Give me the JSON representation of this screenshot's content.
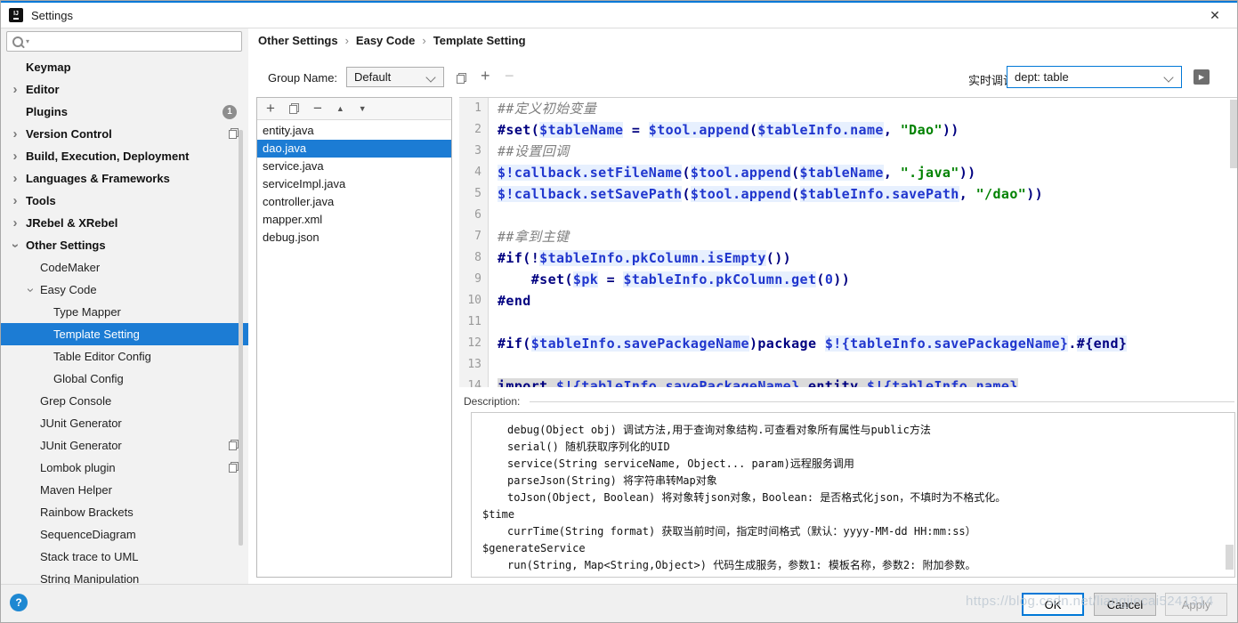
{
  "window": {
    "title": "Settings",
    "close_icon": "✕"
  },
  "colors": {
    "accent_blue": "#0078D7",
    "selection_blue": "#1C7CD4",
    "keyword": "#000080",
    "variable": "#2036CE",
    "string": "#008200",
    "comment": "#808080",
    "help_blue": "#1E88D2"
  },
  "sidebar": {
    "search_value": "",
    "items": [
      {
        "label": "Keymap",
        "level": 1,
        "bold": true
      },
      {
        "label": "Editor",
        "level": 1,
        "bold": true,
        "chevron": "collapsed"
      },
      {
        "label": "Plugins",
        "level": 1,
        "bold": true,
        "badge": "1"
      },
      {
        "label": "Version Control",
        "level": 1,
        "bold": true,
        "chevron": "collapsed",
        "right_icon": "duplicate-icon"
      },
      {
        "label": "Build, Execution, Deployment",
        "level": 1,
        "bold": true,
        "chevron": "collapsed"
      },
      {
        "label": "Languages & Frameworks",
        "level": 1,
        "bold": true,
        "chevron": "collapsed"
      },
      {
        "label": "Tools",
        "level": 1,
        "bold": true,
        "chevron": "collapsed"
      },
      {
        "label": "JRebel & XRebel",
        "level": 1,
        "bold": true,
        "chevron": "collapsed"
      },
      {
        "label": "Other Settings",
        "level": 1,
        "bold": true,
        "chevron": "expanded"
      },
      {
        "label": "CodeMaker",
        "level": 2
      },
      {
        "label": "Easy Code",
        "level": 2,
        "chevron": "expanded"
      },
      {
        "label": "Type Mapper",
        "level": 3
      },
      {
        "label": "Template Setting",
        "level": 3,
        "selected": true
      },
      {
        "label": "Table Editor Config",
        "level": 3
      },
      {
        "label": "Global Config",
        "level": 3
      },
      {
        "label": "Grep Console",
        "level": 2
      },
      {
        "label": "JUnit Generator",
        "level": 2
      },
      {
        "label": "JUnit Generator",
        "level": 2,
        "right_icon": "duplicate-icon"
      },
      {
        "label": "Lombok plugin",
        "level": 2,
        "right_icon": "duplicate-icon"
      },
      {
        "label": "Maven Helper",
        "level": 2
      },
      {
        "label": "Rainbow Brackets",
        "level": 2
      },
      {
        "label": "SequenceDiagram",
        "level": 2
      },
      {
        "label": "Stack trace to UML",
        "level": 2
      },
      {
        "label": "String Manipulation",
        "level": 2
      }
    ]
  },
  "breadcrumb": {
    "items": [
      "Other Settings",
      "Easy Code",
      "Template Setting"
    ],
    "separator": "›"
  },
  "group_row": {
    "label": "Group Name:",
    "value": "Default",
    "icons": {
      "duplicate": "duplicate-icon",
      "add": "+",
      "remove": "−"
    }
  },
  "debug_row": {
    "label": "实时调试",
    "value": "dept: table",
    "run_icon": "▶"
  },
  "file_panel": {
    "toolbar": {
      "add": "+",
      "duplicate": "duplicate-icon",
      "remove": "−",
      "move_up": "▲",
      "move_down": "▼"
    },
    "files": [
      {
        "name": "entity.java"
      },
      {
        "name": "dao.java",
        "selected": true
      },
      {
        "name": "service.java"
      },
      {
        "name": "serviceImpl.java"
      },
      {
        "name": "controller.java"
      },
      {
        "name": "mapper.xml"
      },
      {
        "name": "debug.json"
      }
    ]
  },
  "editor": {
    "lines": [
      {
        "num": "1",
        "tokens": [
          {
            "c": "com",
            "t": "##定义初始变量"
          }
        ]
      },
      {
        "num": "2",
        "tokens": [
          {
            "c": "kw",
            "t": "#set("
          },
          {
            "c": "var hl",
            "t": "$tableName"
          },
          {
            "c": "kw",
            "t": " = "
          },
          {
            "c": "var hl",
            "t": "$tool.append"
          },
          {
            "c": "kw",
            "t": "("
          },
          {
            "c": "var hl",
            "t": "$tableInfo.name"
          },
          {
            "c": "kw",
            "t": ", "
          },
          {
            "c": "str",
            "t": "\"Dao\""
          },
          {
            "c": "kw",
            "t": "))"
          }
        ]
      },
      {
        "num": "3",
        "tokens": [
          {
            "c": "com",
            "t": "##设置回调"
          }
        ]
      },
      {
        "num": "4",
        "tokens": [
          {
            "c": "var hl",
            "t": "$!callback.setFileName"
          },
          {
            "c": "kw",
            "t": "("
          },
          {
            "c": "var hl",
            "t": "$tool.append"
          },
          {
            "c": "kw",
            "t": "("
          },
          {
            "c": "var hl",
            "t": "$tableName"
          },
          {
            "c": "kw",
            "t": ", "
          },
          {
            "c": "str",
            "t": "\".java\""
          },
          {
            "c": "kw",
            "t": "))"
          }
        ]
      },
      {
        "num": "5",
        "tokens": [
          {
            "c": "var hl",
            "t": "$!callback.setSavePath"
          },
          {
            "c": "kw",
            "t": "("
          },
          {
            "c": "var hl",
            "t": "$tool.append"
          },
          {
            "c": "kw",
            "t": "("
          },
          {
            "c": "var hl",
            "t": "$tableInfo.savePath"
          },
          {
            "c": "kw",
            "t": ", "
          },
          {
            "c": "str",
            "t": "\"/dao\""
          },
          {
            "c": "kw",
            "t": "))"
          }
        ]
      },
      {
        "num": "6",
        "tokens": []
      },
      {
        "num": "7",
        "tokens": [
          {
            "c": "com",
            "t": "##拿到主键"
          }
        ]
      },
      {
        "num": "8",
        "tokens": [
          {
            "c": "kw",
            "t": "#if(!"
          },
          {
            "c": "var hl",
            "t": "$tableInfo.pkColumn.isEmpty"
          },
          {
            "c": "kw",
            "t": "())"
          }
        ]
      },
      {
        "num": "9",
        "tokens": [
          {
            "c": "kw",
            "t": "    #set("
          },
          {
            "c": "var hl",
            "t": "$pk"
          },
          {
            "c": "kw",
            "t": " = "
          },
          {
            "c": "var hl",
            "t": "$tableInfo.pkColumn.get"
          },
          {
            "c": "kw",
            "t": "("
          },
          {
            "c": "var",
            "t": "0"
          },
          {
            "c": "kw",
            "t": "))"
          }
        ]
      },
      {
        "num": "10",
        "tokens": [
          {
            "c": "kw",
            "t": "#end"
          }
        ]
      },
      {
        "num": "11",
        "tokens": []
      },
      {
        "num": "12",
        "tokens": [
          {
            "c": "kw",
            "t": "#if("
          },
          {
            "c": "var hl",
            "t": "$tableInfo.savePackageName"
          },
          {
            "c": "kw",
            "t": ")package "
          },
          {
            "c": "var hl",
            "t": "$!{tableInfo.savePackageName}"
          },
          {
            "c": "kw",
            "t": "."
          },
          {
            "c": "kw hl",
            "t": "#{end}"
          }
        ]
      },
      {
        "num": "13",
        "tokens": []
      },
      {
        "num": "14",
        "tokens": [
          {
            "c": "kw sel",
            "t": "import "
          },
          {
            "c": "var sel",
            "t": "$!{tableInfo.savePackageName}"
          },
          {
            "c": "kw sel",
            "t": ".entity."
          },
          {
            "c": "var sel",
            "t": "$!{tableInfo.name}"
          }
        ]
      }
    ]
  },
  "description": {
    "label": "Description:",
    "lines": [
      {
        "indent": 2,
        "text": "debug(Object obj) 调试方法,用于查询对象结构.可查看对象所有属性与public方法"
      },
      {
        "indent": 2,
        "text": "serial() 随机获取序列化的UID"
      },
      {
        "indent": 2,
        "text": "service(String serviceName, Object... param)远程服务调用"
      },
      {
        "indent": 2,
        "text": "parseJson(String) 将字符串转Map对象"
      },
      {
        "indent": 2,
        "text": "toJson(Object, Boolean) 将对象转json对象，Boolean: 是否格式化json，不填时为不格式化。"
      },
      {
        "indent": 1,
        "text": "$time"
      },
      {
        "indent": 2,
        "text": "currTime(String format) 获取当前时间，指定时间格式（默认：yyyy-MM-dd HH:mm:ss）"
      },
      {
        "indent": 1,
        "text": "$generateService"
      },
      {
        "indent": 2,
        "text": "run(String, Map<String,Object>) 代码生成服务，参数1: 模板名称，参数2: 附加参数。"
      }
    ]
  },
  "footer": {
    "help": "?",
    "ok": "OK",
    "cancel": "Cancel",
    "apply": "Apply"
  },
  "watermark": "https://blog.csdn.net/liangjiecai5241314"
}
